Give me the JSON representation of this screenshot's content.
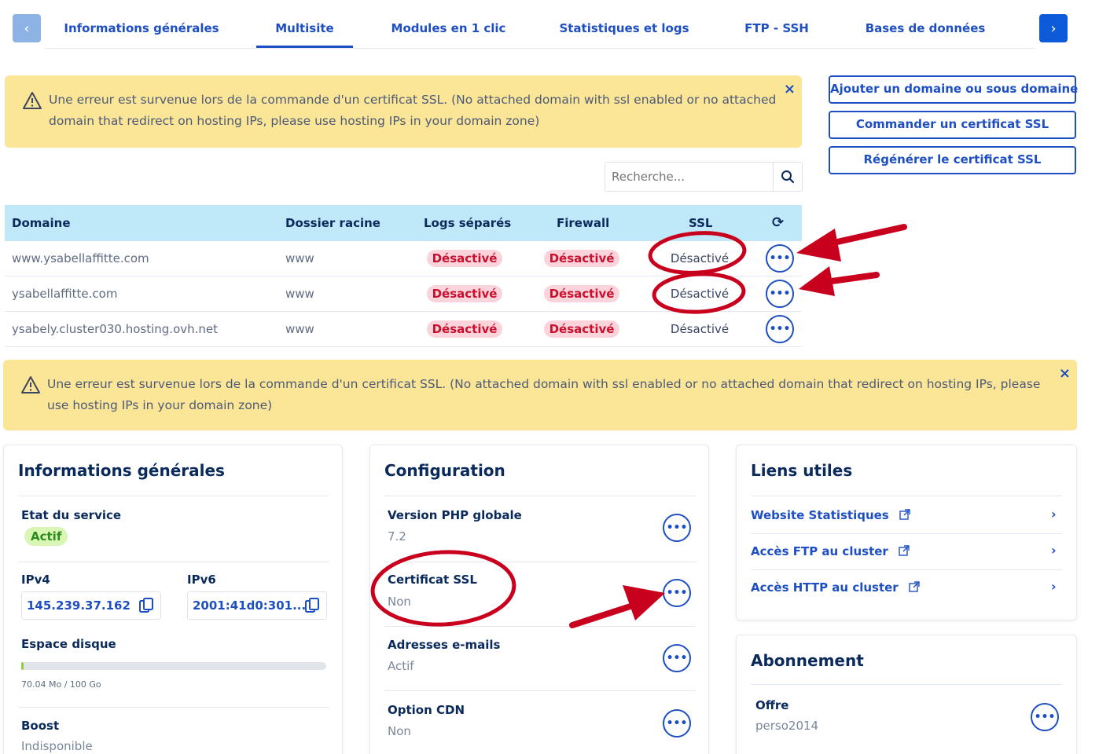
{
  "tabs": {
    "prev_icon": "‹",
    "next_icon": "›",
    "items": [
      {
        "label": "Informations générales"
      },
      {
        "label": "Multisite"
      },
      {
        "label": "Modules en 1 clic"
      },
      {
        "label": "Statistiques et logs"
      },
      {
        "label": "FTP - SSH"
      },
      {
        "label": "Bases de données"
      }
    ],
    "active": "Multisite"
  },
  "banner_top": {
    "message": "Une erreur est survenue lors de la commande d'un certificat SSL. (No attached domain with ssl enabled or no attached domain that redirect on hosting IPs, please use hosting IPs in your domain zone)",
    "close": "×"
  },
  "actions": {
    "add_domain": "Ajouter un domaine ou sous domaine",
    "order_ssl": "Commander un certificat SSL",
    "regen_ssl": "Régénérer le certificat SSL"
  },
  "search": {
    "placeholder": "Recherche..."
  },
  "table": {
    "headers": {
      "domain": "Domaine",
      "root": "Dossier racine",
      "logs": "Logs séparés",
      "firewall": "Firewall",
      "ssl": "SSL",
      "refresh_icon": "⟳"
    },
    "rows": [
      {
        "domain": "www.ysabellaffitte.com",
        "root": "www",
        "logs": "Désactivé",
        "firewall": "Désactivé",
        "ssl": "Désactivé"
      },
      {
        "domain": "ysabellaffitte.com",
        "root": "www",
        "logs": "Désactivé",
        "firewall": "Désactivé",
        "ssl": "Désactivé"
      },
      {
        "domain": "ysabely.cluster030.hosting.ovh.net",
        "root": "www",
        "logs": "Désactivé",
        "firewall": "Désactivé",
        "ssl": "Désactivé"
      }
    ],
    "menu_icon": "•••"
  },
  "banner_bottom": {
    "message": "Une erreur est survenue lors de la commande d'un certificat SSL. (No attached domain with ssl enabled or no attached domain that redirect on hosting IPs, please use hosting IPs in your domain zone)",
    "close": "×"
  },
  "general": {
    "title": "Informations générales",
    "service_state_label": "Etat du service",
    "service_state": "Actif",
    "ipv4_label": "IPv4",
    "ipv4": "145.239.37.162",
    "ipv6_label": "IPv6",
    "ipv6": "2001:41d0:301...",
    "disk_label": "Espace disque",
    "disk_usage": "70.04 Mo / 100 Go",
    "disk_used_fraction": 0.0007,
    "boost_label": "Boost",
    "boost_value": "Indisponible"
  },
  "configuration": {
    "title": "Configuration",
    "items": [
      {
        "label": "Version PHP globale",
        "value": "7.2"
      },
      {
        "label": "Certificat SSL",
        "value": "Non"
      },
      {
        "label": "Adresses e-mails",
        "value": "Actif"
      },
      {
        "label": "Option CDN",
        "value": "Non"
      }
    ]
  },
  "links": {
    "title": "Liens utiles",
    "items": [
      {
        "label": "Website Statistiques"
      },
      {
        "label": "Accès FTP au cluster"
      },
      {
        "label": "Accès HTTP au cluster"
      }
    ],
    "chevron": "›"
  },
  "subscription": {
    "title": "Abonnement",
    "offer_label": "Offre",
    "offer_value": "perso2014"
  },
  "annotation_color": "#c8001e"
}
